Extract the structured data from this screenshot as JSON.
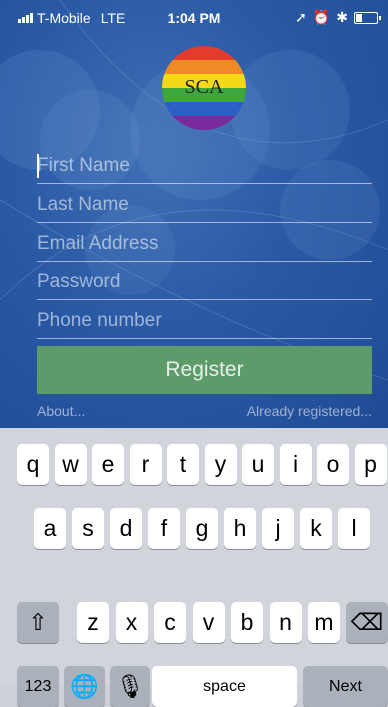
{
  "status": {
    "carrier": "T-Mobile",
    "network": "LTE",
    "time": "1:04 PM"
  },
  "logo": {
    "text": "SCA"
  },
  "form": {
    "first_name_placeholder": "First Name",
    "last_name_placeholder": "Last Name",
    "email_placeholder": "Email Address",
    "password_placeholder": "Password",
    "phone_placeholder": "Phone number",
    "register_label": "Register",
    "about_label": "About...",
    "already_label": "Already registered..."
  },
  "colors": {
    "register_bg": "#5e9b6b",
    "app_bg": "#2a5aa5"
  },
  "keyboard": {
    "row1": [
      "q",
      "w",
      "e",
      "r",
      "t",
      "y",
      "u",
      "i",
      "o",
      "p"
    ],
    "row2": [
      "a",
      "s",
      "d",
      "f",
      "g",
      "h",
      "j",
      "k",
      "l"
    ],
    "row3": [
      "z",
      "x",
      "c",
      "v",
      "b",
      "n",
      "m"
    ],
    "numbers_label": "123",
    "space_label": "space",
    "next_label": "Next",
    "shift_icon": "shift-icon",
    "delete_icon": "delete-icon",
    "globe_icon": "globe-icon",
    "mic_icon": "microphone-icon"
  }
}
